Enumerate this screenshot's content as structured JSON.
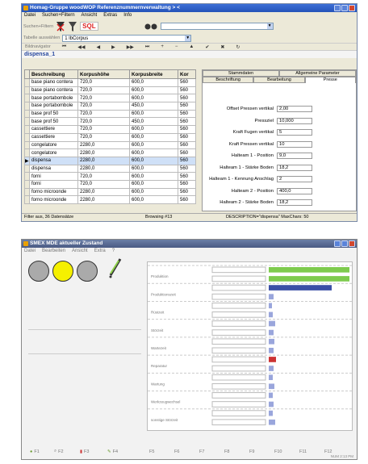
{
  "w1": {
    "title": "Homag-Gruppe woodWOP Referenznummernverwaltung  > <",
    "menu": [
      "Datei",
      "Suchen+Filtern",
      "Ansicht",
      "Extras",
      "Info"
    ],
    "filter_label": "Suchen+Filtern",
    "sql_label": "SQL",
    "table_label": "Tabelle auswählen",
    "table_value": "1 lbCorpus",
    "navigator_label": "Bildnavigator",
    "section_title": "dispensa_1",
    "columns": [
      "Beschreibung",
      "Korpushöhe",
      "Korpusbreite",
      "Kor"
    ],
    "rows": [
      [
        "base piano contera",
        "720,0",
        "600,0",
        "560"
      ],
      [
        "base piano contera",
        "720,0",
        "600,0",
        "560"
      ],
      [
        "base portabombole",
        "720,0",
        "600,0",
        "560"
      ],
      [
        "base portabombole",
        "720,0",
        "450,0",
        "560"
      ],
      [
        "base prof 50",
        "720,0",
        "600,0",
        "560"
      ],
      [
        "base prof 50",
        "720,0",
        "450,0",
        "560"
      ],
      [
        "cassettiere",
        "720,0",
        "600,0",
        "560"
      ],
      [
        "cassettiere",
        "720,0",
        "600,0",
        "560"
      ],
      [
        "congelatore",
        "2280,0",
        "600,0",
        "560"
      ],
      [
        "congelatore",
        "2280,0",
        "600,0",
        "560"
      ],
      [
        "dispensa",
        "2280,0",
        "600,0",
        "560"
      ],
      [
        "dispensa",
        "2280,0",
        "600,0",
        "560"
      ],
      [
        "forni",
        "720,0",
        "600,0",
        "560"
      ],
      [
        "forni",
        "720,0",
        "600,0",
        "560"
      ],
      [
        "forno microonde",
        "2280,0",
        "600,0",
        "560"
      ],
      [
        "forno microonde",
        "2280,0",
        "600,0",
        "560"
      ]
    ],
    "selected_row": 10,
    "tabs_top": [
      "Stammdaten",
      "Allgemeine Parameter"
    ],
    "tabs_bottom": [
      "Beschriftung",
      "Bearbeitung",
      "Presse"
    ],
    "properties": [
      {
        "label": "Offset Pressen vertikal",
        "value": "2,00"
      },
      {
        "label": "Pressziel",
        "value": "10,000"
      },
      {
        "label": "Kraft Fugen vertikal",
        "value": "5"
      },
      {
        "label": "Kraft Pressen vertikal",
        "value": "10"
      },
      {
        "label": "Halteam 1 - Position",
        "value": "9,0"
      },
      {
        "label": "Halteam 1 - Stärke Boden",
        "value": "18,2"
      },
      {
        "label": "Halteam 1 - Kennung Anschlag",
        "value": "2"
      },
      {
        "label": "Halteam 2 - Position",
        "value": "400,0"
      },
      {
        "label": "Halteam 2 - Stärke Boden",
        "value": "18,2"
      }
    ],
    "status": [
      "Filter aus, 36 Datensätze",
      "Browsing #13",
      "DESCRIPTION=\"dispensa\"  MaxChars: 50"
    ]
  },
  "w2": {
    "title": "SMEX MDE  aktueller Zustand",
    "menu": [
      "Datei",
      "Bearbeiten",
      "Ansicht",
      "Extra",
      "?"
    ],
    "fkeys": [
      "F1",
      "F2",
      "F3",
      "F4"
    ],
    "fkeys_right": [
      "F5",
      "F6",
      "F7",
      "F8",
      "F9",
      "F10",
      "F11",
      "F12"
    ],
    "status_right": "NUM   2:13 PM",
    "categories": [
      "Produktion",
      "Produktionszeit",
      "Rüstzeit",
      "Störzeit",
      "Wartezeit",
      "Reparatur",
      "Wartung",
      "Werkzeugwechsel",
      "sonstige Störzeit"
    ],
    "bar_colors": [
      "#7ecb4e",
      "#7ecb4e",
      "#3a4fa6",
      "#9fb0e0",
      "#7f8fd8",
      "#a0a8d8",
      "#c33",
      "#9aa6dc"
    ],
    "bar_fracs": [
      1.0,
      1.0,
      0.78,
      0.06,
      0.04,
      0.05,
      0.08,
      0.06,
      0.07,
      0.06,
      0.09,
      0.06,
      0.05,
      0.07,
      0.05,
      0.06,
      0.05,
      0.08
    ]
  }
}
